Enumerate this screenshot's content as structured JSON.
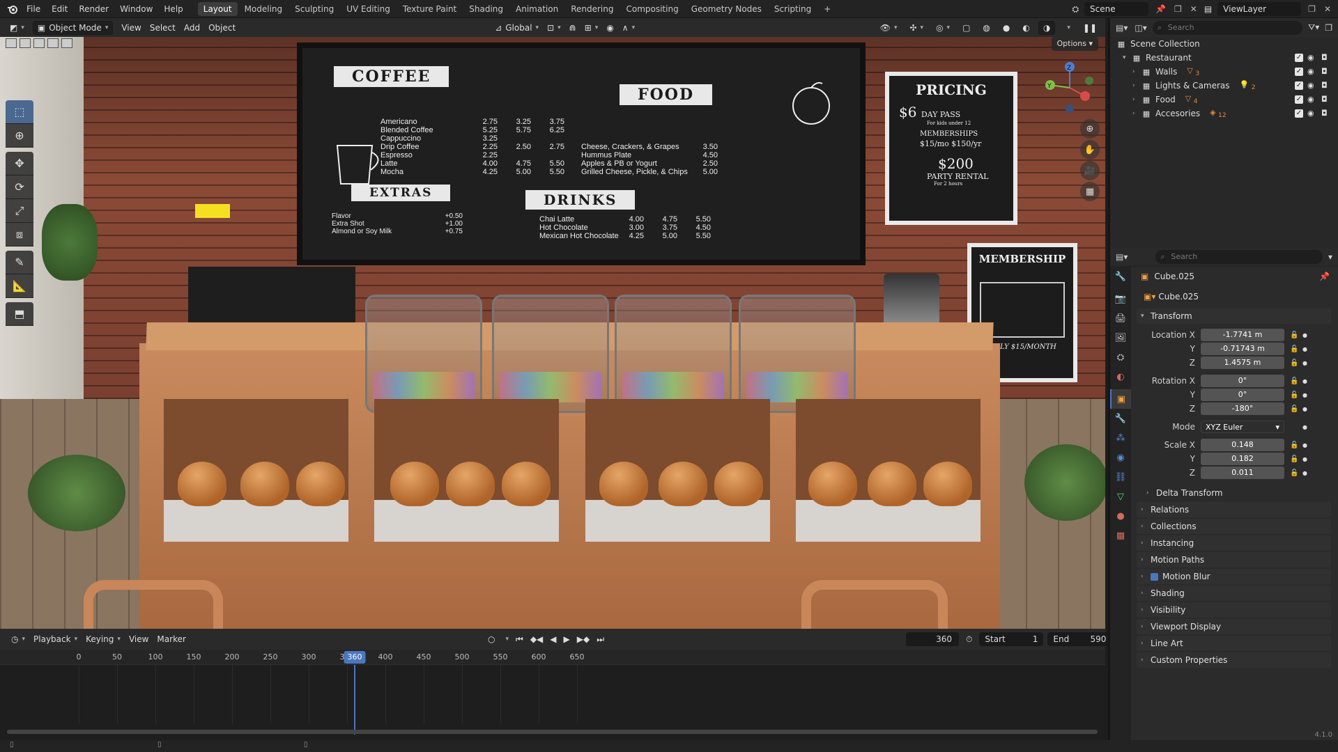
{
  "topbar": {
    "menus": [
      "File",
      "Edit",
      "Render",
      "Window",
      "Help"
    ],
    "workspaces": [
      "Layout",
      "Modeling",
      "Sculpting",
      "UV Editing",
      "Texture Paint",
      "Shading",
      "Animation",
      "Rendering",
      "Compositing",
      "Geometry Nodes",
      "Scripting"
    ],
    "active_workspace": "Layout",
    "add_tab": "+",
    "scene": "Scene",
    "view_layer": "ViewLayer"
  },
  "viewport_header": {
    "mode": "Object Mode",
    "menus": [
      "View",
      "Select",
      "Add",
      "Object"
    ],
    "orientation": "Global",
    "options": "Options"
  },
  "scene_content": {
    "coffee": {
      "title": "COFFEE",
      "items": [
        {
          "name": "Americano",
          "p": [
            "2.75",
            "3.25",
            "3.75"
          ]
        },
        {
          "name": "Blended Coffee",
          "p": [
            "5.25",
            "5.75",
            "6.25"
          ]
        },
        {
          "name": "Cappuccino",
          "p": [
            "3.25",
            "",
            ""
          ]
        },
        {
          "name": "Drip Coffee",
          "p": [
            "2.25",
            "2.50",
            "2.75"
          ]
        },
        {
          "name": "Espresso",
          "p": [
            "2.25",
            "",
            ""
          ]
        },
        {
          "name": "Latte",
          "p": [
            "4.00",
            "4.75",
            "5.50"
          ]
        },
        {
          "name": "Mocha",
          "p": [
            "4.25",
            "5.00",
            "5.50"
          ]
        }
      ]
    },
    "food": {
      "title": "FOOD",
      "items": [
        {
          "name": "Cheese, Crackers, & Grapes",
          "p": "3.50"
        },
        {
          "name": "Hummus Plate",
          "p": "4.50"
        },
        {
          "name": "Apples & PB or Yogurt",
          "p": "2.50"
        },
        {
          "name": "Grilled Cheese, Pickle, & Chips",
          "p": "5.00"
        }
      ]
    },
    "extras": {
      "title": "EXTRAS",
      "items": [
        {
          "name": "Flavor",
          "p": "+0.50"
        },
        {
          "name": "Extra Shot",
          "p": "+1.00"
        },
        {
          "name": "Almond or Soy Milk",
          "p": "+0.75"
        }
      ]
    },
    "drinks": {
      "title": "DRINKS",
      "items": [
        {
          "name": "Chai Latte",
          "p": [
            "4.00",
            "4.75",
            "5.50"
          ]
        },
        {
          "name": "Hot Chocolate",
          "p": [
            "3.00",
            "3.75",
            "4.50"
          ]
        },
        {
          "name": "Mexican Hot Chocolate",
          "p": [
            "4.25",
            "5.00",
            "5.50"
          ]
        }
      ]
    },
    "pricing": {
      "title": "PRICING",
      "line1": "$6",
      "line1b": "DAY PASS",
      "line1c": "For kids under 12",
      "line2": "MEMBERSHIPS",
      "line2b": "$15/mo  $150/yr",
      "line3": "$200",
      "line3b": "PARTY RENTAL",
      "line3c": "For 2 hours"
    },
    "membership": {
      "title": "MEMBERSHIP",
      "tag": "ONLY $15/MONTH"
    }
  },
  "tools": [
    "select",
    "cursor",
    "move",
    "rotate",
    "scale",
    "transform",
    "annotate",
    "measure",
    "add-cube"
  ],
  "timeline": {
    "menus": [
      "Playback",
      "Keying",
      "View",
      "Marker"
    ],
    "current_frame": "360",
    "start_label": "Start",
    "start": "1",
    "end_label": "End",
    "end": "590",
    "ticks": [
      "0",
      "50",
      "100",
      "150",
      "200",
      "250",
      "300",
      "350",
      "400",
      "450",
      "500",
      "550",
      "600",
      "650"
    ],
    "playhead_label": "360"
  },
  "outliner": {
    "search_placeholder": "Search",
    "root": "Scene Collection",
    "collection": "Restaurant",
    "children": [
      {
        "name": "Walls",
        "badge": "3"
      },
      {
        "name": "Lights & Cameras",
        "badge": "2"
      },
      {
        "name": "Food",
        "badge": "4"
      },
      {
        "name": "Accesories",
        "badge": "12"
      }
    ]
  },
  "properties": {
    "search_placeholder": "Search",
    "object_name": "Cube.025",
    "object_field": "Cube.025",
    "transform_label": "Transform",
    "location_label": "Location X",
    "location": [
      "-1.7741 m",
      "-0.71743 m",
      "1.4575 m"
    ],
    "rotation_label": "Rotation X",
    "rotation": [
      "0°",
      "0°",
      "-180°"
    ],
    "mode_label": "Mode",
    "mode": "XYZ Euler",
    "scale_label": "Scale X",
    "scale": [
      "0.148",
      "0.182",
      "0.011"
    ],
    "axis_y": "Y",
    "axis_z": "Z",
    "delta_transform": "Delta Transform",
    "panels": [
      "Relations",
      "Collections",
      "Instancing",
      "Motion Paths",
      "Motion Blur",
      "Shading",
      "Visibility",
      "Viewport Display",
      "Line Art",
      "Custom Properties"
    ]
  },
  "status": {
    "version": "4.1.0"
  },
  "colors": {
    "accent": "#4b77be",
    "panel_bg": "#2b2b2b",
    "header_bg": "#2a2a2a"
  }
}
